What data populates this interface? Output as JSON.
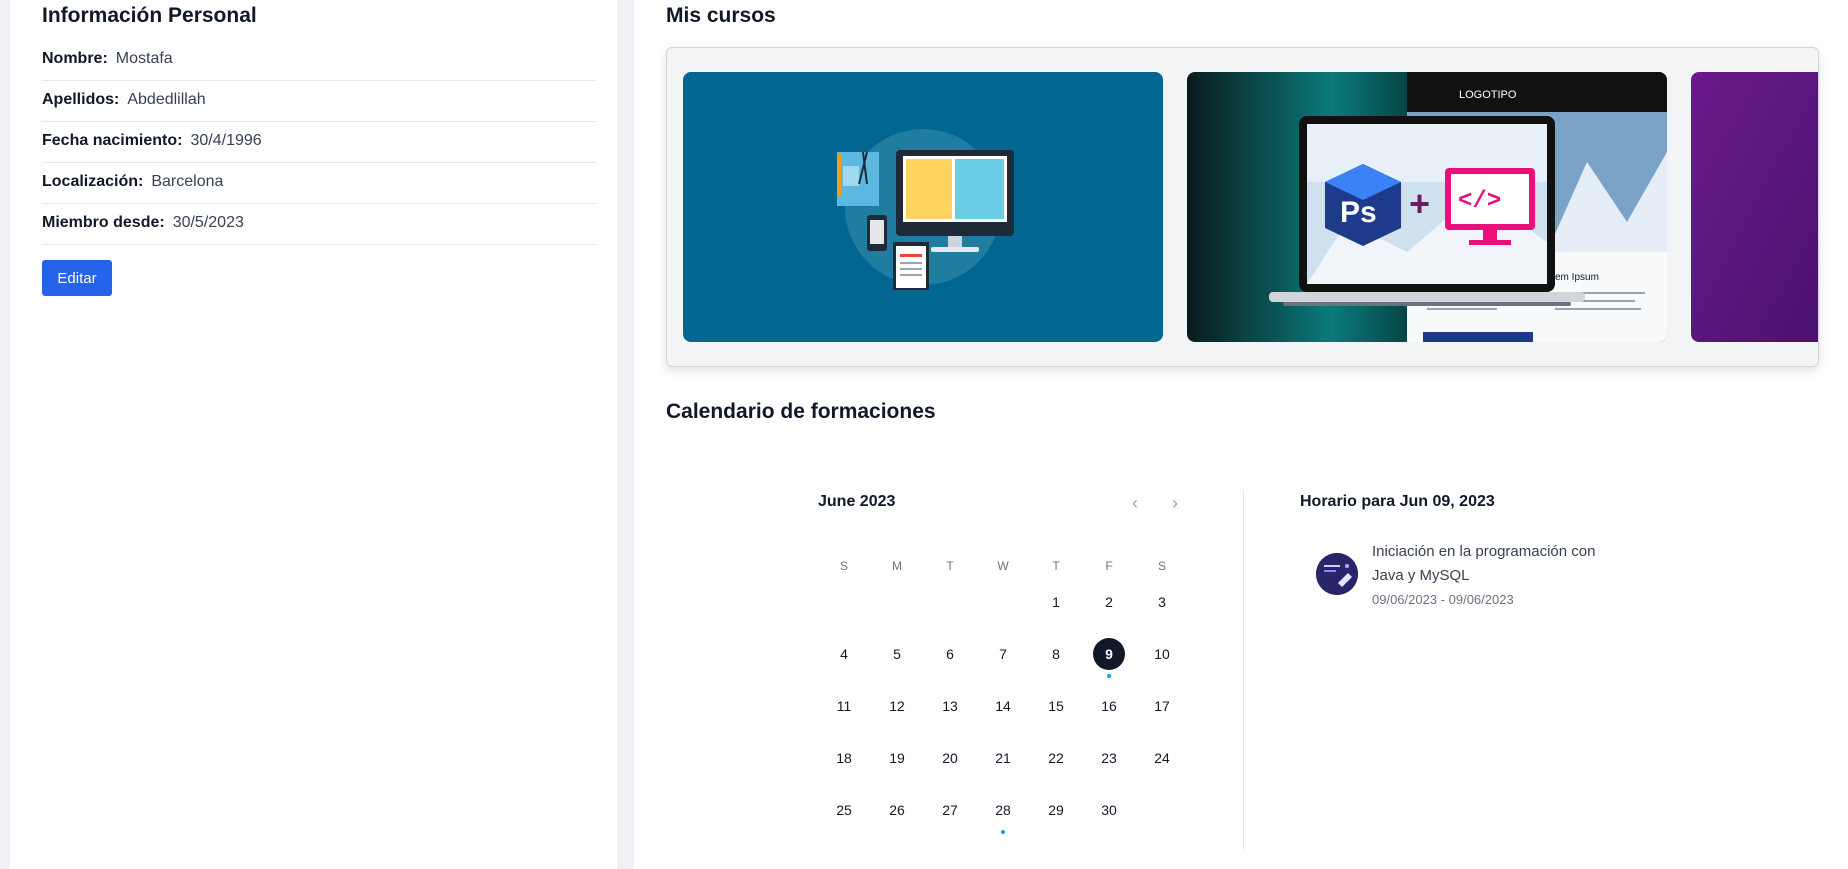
{
  "profile": {
    "title": "Información Personal",
    "fields": [
      {
        "label": "Nombre:",
        "value": "Mostafa"
      },
      {
        "label": "Apellidos:",
        "value": "Abdedlillah"
      },
      {
        "label": "Fecha nacimiento:",
        "value": "30/4/1996"
      },
      {
        "label": "Localización:",
        "value": "Barcelona"
      },
      {
        "label": "Miembro desde:",
        "value": "30/5/2023"
      }
    ],
    "edit_label": "Editar"
  },
  "courses": {
    "title": "Mis cursos",
    "slide2_logo": "LOGOTIPO",
    "slide2_heading": "em Ipsum"
  },
  "calendar": {
    "title": "Calendario de formaciones",
    "month": "June 2023",
    "prev_icon": "‹",
    "next_icon": "›",
    "weekdays": [
      "S",
      "M",
      "T",
      "W",
      "T",
      "F",
      "S"
    ],
    "selected_day": 9,
    "event_days": [
      9,
      28
    ],
    "days": [
      "1",
      "2",
      "3",
      "4",
      "5",
      "6",
      "7",
      "8",
      "9",
      "10",
      "11",
      "12",
      "13",
      "14",
      "15",
      "16",
      "17",
      "18",
      "19",
      "20",
      "21",
      "22",
      "23",
      "24",
      "25",
      "26",
      "27",
      "28",
      "29",
      "30"
    ],
    "schedule_title": "Horario para Jun 09, 2023",
    "event": {
      "name": "Iniciación en la programación con Java y MySQL",
      "dates": "09/06/2023 - 09/06/2023"
    },
    "accent_color": "#0ea5e9"
  }
}
